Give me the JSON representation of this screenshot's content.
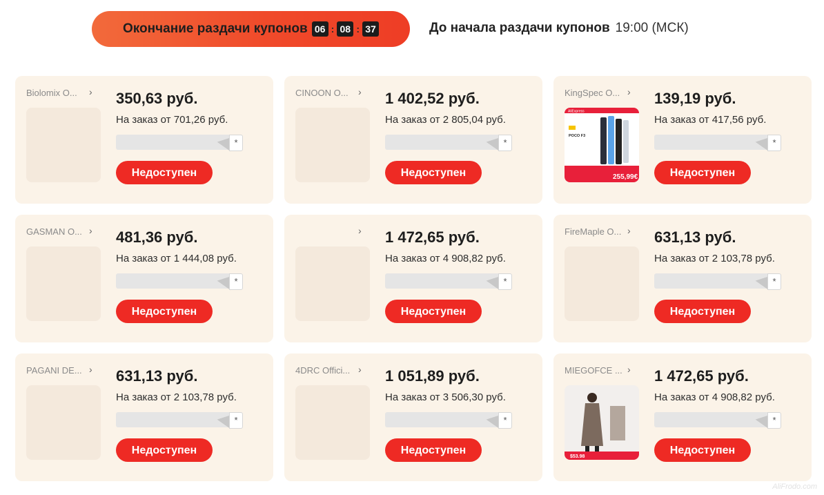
{
  "header": {
    "ending_label": "Окончание раздачи купонов",
    "timer": {
      "hh": "06",
      "mm": "08",
      "ss": "37"
    },
    "start_label": "До начала раздачи купонов",
    "start_time": "19:00 (МСК)"
  },
  "cards": [
    {
      "store": "Biolomix O...",
      "price": "350,63 руб.",
      "min_order": "На заказ от 701,26 руб.",
      "button": "Недоступен",
      "image": "blank"
    },
    {
      "store": "CINOON O...",
      "price": "1 402,52 руб.",
      "min_order": "На заказ от 2 805,04 руб.",
      "button": "Недоступен",
      "image": "blank"
    },
    {
      "store": "KingSpec O...",
      "price": "139,19 руб.",
      "min_order": "На заказ от 417,56 руб.",
      "button": "Недоступен",
      "image": "phone-ad",
      "image_text": {
        "brand": "AliExpress",
        "model": "POCO F3",
        "price": "255,99€"
      }
    },
    {
      "store": "GASMAN O...",
      "price": "481,36 руб.",
      "min_order": "На заказ от 1 444,08 руб.",
      "button": "Недоступен",
      "image": "blank"
    },
    {
      "store": "",
      "price": "1 472,65 руб.",
      "min_order": "На заказ от 4 908,82 руб.",
      "button": "Недоступен",
      "image": "blank"
    },
    {
      "store": "FireMaple O...",
      "price": "631,13 руб.",
      "min_order": "На заказ от 2 103,78 руб.",
      "button": "Недоступен",
      "image": "blank"
    },
    {
      "store": "PAGANI DE...",
      "price": "631,13 руб.",
      "min_order": "На заказ от 2 103,78 руб.",
      "button": "Недоступен",
      "image": "blank"
    },
    {
      "store": "4DRC Offici...",
      "price": "1 051,89 руб.",
      "min_order": "На заказ от 3 506,30 руб.",
      "button": "Недоступен",
      "image": "blank"
    },
    {
      "store": "MIEGOFCE ...",
      "price": "1 472,65 руб.",
      "min_order": "На заказ от 4 908,82 руб.",
      "button": "Недоступен",
      "image": "coat-photo",
      "image_text": {
        "price": "$53.98"
      }
    }
  ],
  "chevron_glyph": "›",
  "star_glyph": "*",
  "colors": {
    "accent_red": "#ee2a24",
    "card_bg": "#fbf3e8",
    "pill_start": "#f26a3b",
    "pill_end": "#ee3d25"
  },
  "watermark": "AliFrodo.com"
}
